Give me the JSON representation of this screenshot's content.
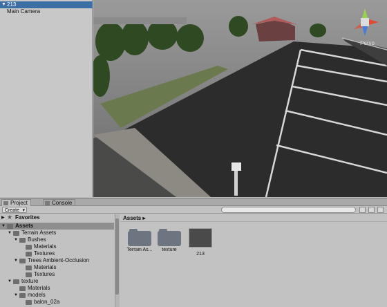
{
  "hierarchy": {
    "items": [
      {
        "label": "213",
        "selected": true,
        "expandable": true
      },
      {
        "label": "Main Camera",
        "selected": false,
        "expandable": false
      }
    ]
  },
  "scene": {
    "projection_label": "Persp",
    "gizmo_axes": [
      "y",
      "x",
      "z"
    ]
  },
  "bottom": {
    "tabs": [
      {
        "label": "Project",
        "icon": "folder-icon",
        "active": true
      },
      {
        "label": "Console",
        "icon": "console-icon",
        "active": false
      }
    ],
    "create_label": "Create",
    "search_placeholder": ""
  },
  "project_tree": {
    "favorites_label": "Favorites",
    "rows": [
      {
        "label": "Assets",
        "depth": 0,
        "expanded": true,
        "selected": true
      },
      {
        "label": "Terrain Assets",
        "depth": 1,
        "expanded": true,
        "selected": false
      },
      {
        "label": "Bushes",
        "depth": 2,
        "expanded": true,
        "selected": false
      },
      {
        "label": "Materials",
        "depth": 3,
        "expanded": null,
        "selected": false
      },
      {
        "label": "Textures",
        "depth": 3,
        "expanded": null,
        "selected": false
      },
      {
        "label": "Trees Ambient-Occlusion",
        "depth": 2,
        "expanded": true,
        "selected": false
      },
      {
        "label": "Materials",
        "depth": 3,
        "expanded": null,
        "selected": false
      },
      {
        "label": "Textures",
        "depth": 3,
        "expanded": null,
        "selected": false
      },
      {
        "label": "texture",
        "depth": 1,
        "expanded": true,
        "selected": false
      },
      {
        "label": "Materials",
        "depth": 2,
        "expanded": null,
        "selected": false
      },
      {
        "label": "models",
        "depth": 2,
        "expanded": true,
        "selected": false
      },
      {
        "label": "balon_02a",
        "depth": 3,
        "expanded": null,
        "selected": false
      }
    ]
  },
  "assets_panel": {
    "breadcrumb": "Assets ▸",
    "items": [
      {
        "label": "Terrain As...",
        "kind": "folder"
      },
      {
        "label": "texture",
        "kind": "folder"
      },
      {
        "label": "213",
        "kind": "model"
      }
    ]
  }
}
